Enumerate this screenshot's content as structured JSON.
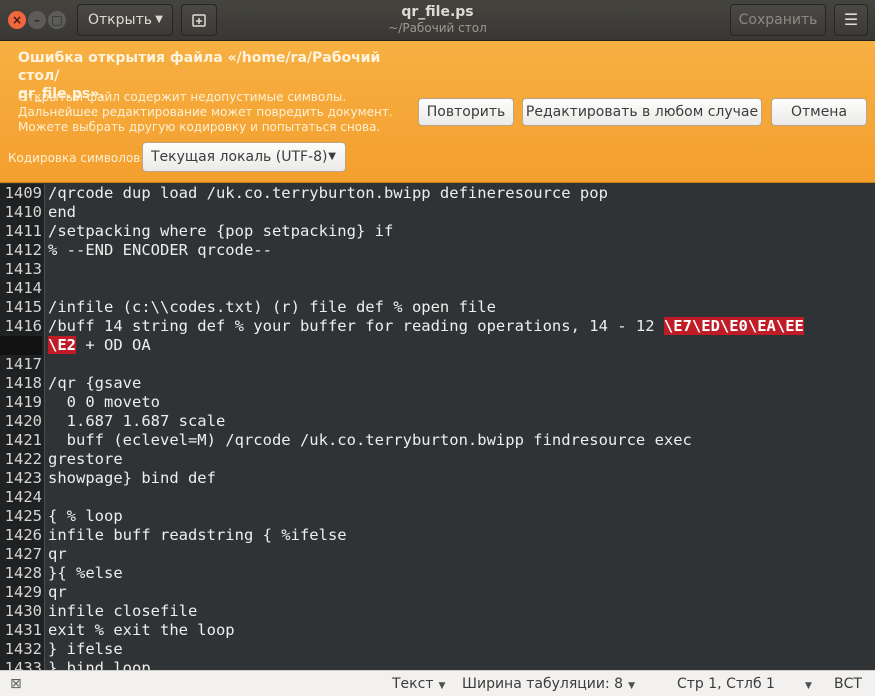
{
  "header": {
    "open_label": "Открыть",
    "title": "qr_file.ps",
    "subtitle": "~/Рабочий стол",
    "save_label": "Сохранить"
  },
  "infobar": {
    "error_title": "Ошибка открытия файла «/home/ra/Рабочий стол/\nqr_file.ps».",
    "error_message": "Открытый файл содержит недопустимые символы. Дальнейшее редактирование может повредить документ.\nМожете выбрать другую кодировку и попытаться снова.",
    "retry_label": "Повторить",
    "edit_label": "Редактировать в любом случае",
    "cancel_label": "Отмена",
    "encoding_label": "Кодировка символов:",
    "encoding_value": "Текущая локаль (UTF-8)"
  },
  "editor": {
    "lines": [
      {
        "n": "1409",
        "text": "/qrcode dup load /uk.co.terryburton.bwipp defineresource pop"
      },
      {
        "n": "1410",
        "text": "end"
      },
      {
        "n": "1411",
        "text": "/setpacking where {pop setpacking} if"
      },
      {
        "n": "1412",
        "text": "% --END ENCODER qrcode--"
      },
      {
        "n": "1413",
        "text": ""
      },
      {
        "n": "1414",
        "text": ""
      },
      {
        "n": "1415",
        "text": "/infile (c:\\\\codes.txt) (r) file def % open file"
      },
      {
        "n": "1416",
        "text": "/buff 14 string def % your buffer for reading operations, 14 - 12 ",
        "bad": "\\E7\\ED\\E0\\EA\\EE"
      },
      {
        "n": "",
        "text": " + OD OA",
        "bad_prefix": "\\E2",
        "cont": true
      },
      {
        "n": "1417",
        "text": ""
      },
      {
        "n": "1418",
        "text": "/qr {gsave"
      },
      {
        "n": "1419",
        "text": "  0 0 moveto"
      },
      {
        "n": "1420",
        "text": "  1.687 1.687 scale"
      },
      {
        "n": "1421",
        "text": "  buff (eclevel=M) /qrcode /uk.co.terryburton.bwipp findresource exec"
      },
      {
        "n": "1422",
        "text": "grestore"
      },
      {
        "n": "1423",
        "text": "showpage} bind def"
      },
      {
        "n": "1424",
        "text": ""
      },
      {
        "n": "1425",
        "text": "{ % loop"
      },
      {
        "n": "1426",
        "text": "infile buff readstring { %ifelse"
      },
      {
        "n": "1427",
        "text": "qr"
      },
      {
        "n": "1428",
        "text": "}{ %else"
      },
      {
        "n": "1429",
        "text": "qr"
      },
      {
        "n": "1430",
        "text": "infile closefile"
      },
      {
        "n": "1431",
        "text": "exit % exit the loop"
      },
      {
        "n": "1432",
        "text": "} ifelse"
      },
      {
        "n": "1433",
        "text": "} bind loop"
      }
    ]
  },
  "statusbar": {
    "language": "Текст",
    "tab_width": "Ширина табуляции: 8",
    "position": "Стр 1, Стлб 1",
    "insert_mode": "ВСТ"
  }
}
